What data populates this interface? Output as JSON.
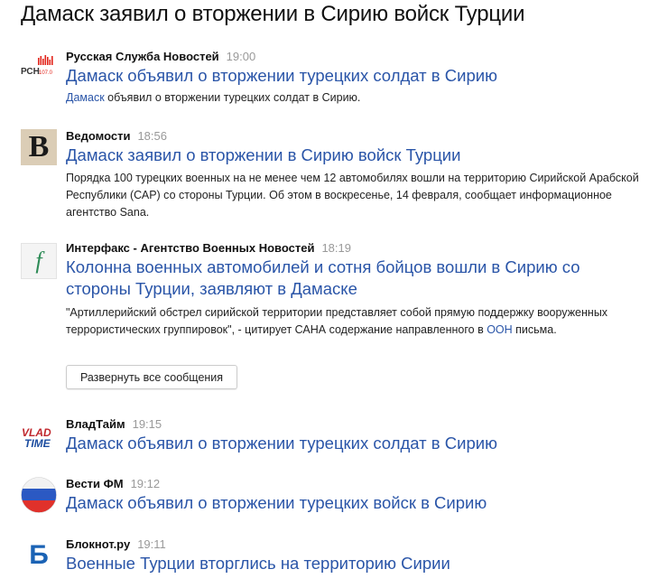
{
  "page_title": "Дамаск заявил о вторжении в Сирию войск Турции",
  "items": [
    {
      "source": "Русская Служба Новостей",
      "time": "19:00",
      "logo_text": "РСН",
      "logo_sub": "107.0",
      "headline": "Дамаск объявил о вторжении турецких солдат в Сирию",
      "snippet_link": "Дамаск",
      "snippet_rest": " объявил о вторжении турецких солдат в Сирию."
    },
    {
      "source": "Ведомости",
      "time": "18:56",
      "logo_text": "В",
      "headline": "Дамаск заявил о вторжении в Сирию войск Турции",
      "snippet": "Порядка 100 турецких военных на не менее чем 12 автомобилях вошли на территорию Сирийской Арабской Республики (САР) со стороны Турции. Об этом в воскресенье, 14 февраля, сообщает информационное агентство Sana."
    },
    {
      "source": "Интерфакс - Агентство Военных Новостей",
      "time": "18:19",
      "logo_text": "f",
      "headline": "Колонна военных автомобилей и сотня бойцов вошли в Сирию со стороны Турции, заявляют в Дамаске",
      "snippet_pre": "\"Артиллерийский обстрел сирийской территории представляет собой прямую поддержку вооруженных террористических группировок\", - цитирует САНА содержание направленного в ",
      "snippet_link": "ООН",
      "snippet_post": " письма."
    },
    {
      "source": "ВладТайм",
      "time": "19:15",
      "logo_text_1": "VLAD",
      "logo_text_2": "TIME",
      "headline": "Дамаск объявил о вторжении турецких солдат в Сирию"
    },
    {
      "source": "Вести ФМ",
      "time": "19:12",
      "headline": "Дамаск объявил о вторжении турецких войск в Сирию"
    },
    {
      "source": "Блокнот.ру",
      "time": "19:11",
      "logo_text": "Б",
      "headline": "Военные Турции вторглись на территорию Сирии"
    }
  ],
  "expand_button": "Развернуть все сообщения",
  "colors": {
    "link": "#2a55a8",
    "time": "#999999",
    "rsn_red": "#e2241b",
    "vedomosti_bg": "#dbcdb6",
    "interfax_green": "#2e8b57",
    "blocknot_blue": "#1b63b5"
  }
}
